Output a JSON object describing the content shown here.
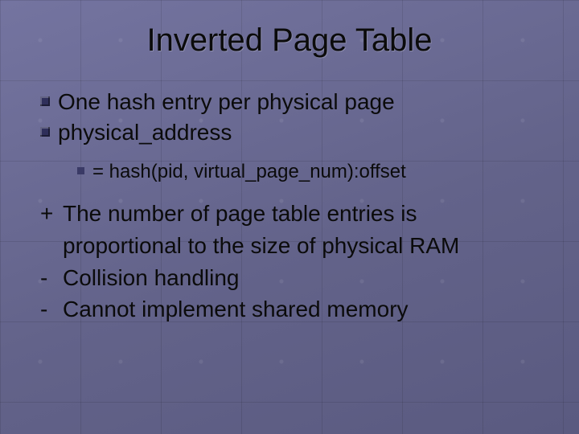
{
  "title": "Inverted Page Table",
  "bullets": [
    "One hash entry per physical page",
    "physical_address"
  ],
  "sub_bullet": "= hash(pid, virtual_page_num):offset",
  "lines": {
    "plus_mark": "+",
    "plus_text_a": "The number of page table entries is",
    "plus_text_b": "proportional to the size of physical RAM",
    "minus1_mark": "-",
    "minus1_text": "Collision handling",
    "minus2_mark": "-",
    "minus2_text": "Cannot implement shared memory"
  }
}
